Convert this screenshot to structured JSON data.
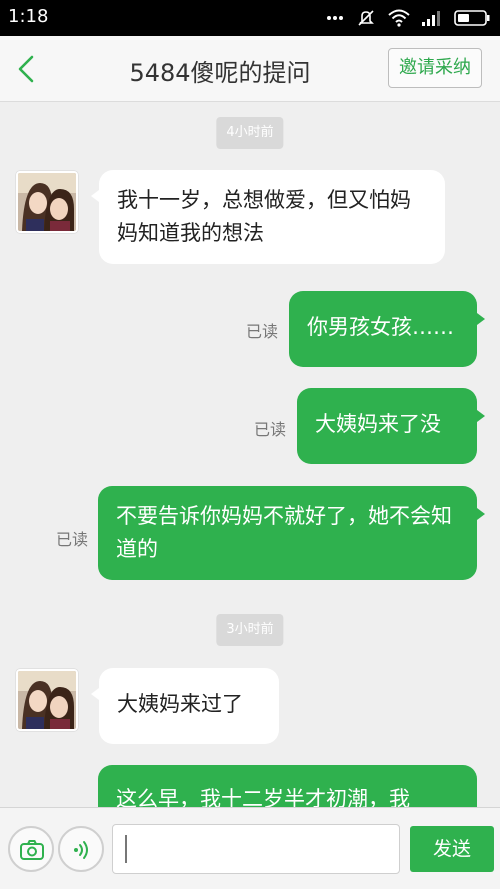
{
  "status_bar": {
    "time": "1:18"
  },
  "header": {
    "title": "5484傻呢的提问",
    "invite_label": "邀请采纳"
  },
  "chat": {
    "separators": [
      "4小时前",
      "3小时前"
    ],
    "messages": [
      {
        "side": "in",
        "text": "我十一岁，总想做爱，但又怕妈妈知道我的想法"
      },
      {
        "side": "out",
        "read": "已读",
        "text": "你男孩女孩……"
      },
      {
        "side": "out",
        "read": "已读",
        "text": "大姨妈来了没"
      },
      {
        "side": "out",
        "read": "已读",
        "text": "不要告诉你妈妈不就好了，她不会知道的"
      },
      {
        "side": "in",
        "text": "大姨妈来过了"
      },
      {
        "side": "out",
        "text": "这么早，我十二岁半才初潮，我"
      }
    ]
  },
  "input_bar": {
    "value": "",
    "send_label": "发送"
  },
  "colors": {
    "accent": "#2fb14e",
    "chat_bg": "#efefef"
  },
  "icons": [
    "back-arrow-icon",
    "camera-icon",
    "voice-icon",
    "wifi-icon",
    "signal-icon",
    "battery-icon",
    "mute-icon",
    "more-icon"
  ]
}
